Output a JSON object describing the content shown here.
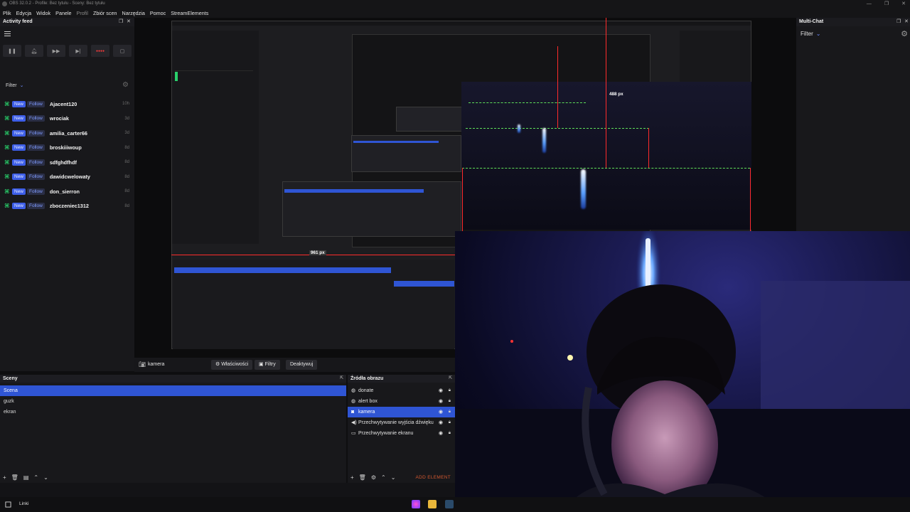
{
  "window": {
    "title": "OBS 32.0.2 - Profile: Bez tytułu - Sceny: Bez tytułu",
    "controls": [
      "—",
      "❐",
      "✕"
    ]
  },
  "menu": {
    "items": [
      "Plik",
      "Edycja",
      "Widok",
      "Panele",
      "Profil",
      "Zbiór scen",
      "Narzędzia",
      "Pomoc",
      "StreamElements"
    ]
  },
  "activity_feed": {
    "title": "Activity feed",
    "filter_label": "Filter",
    "badge_new": "New",
    "badge_follow": "Follow",
    "items": [
      {
        "name": "Ajacent120",
        "time": "10h"
      },
      {
        "name": "wrociak",
        "time": "3d"
      },
      {
        "name": "amilia_carter66",
        "time": "3d"
      },
      {
        "name": "broskiiiwoup",
        "time": "8d"
      },
      {
        "name": "sdfghdfhdf",
        "time": "8d"
      },
      {
        "name": "dawidcwelowaty",
        "time": "8d"
      },
      {
        "name": "don_sierron",
        "time": "8d"
      },
      {
        "name": "zboczeniec1312",
        "time": "8d"
      }
    ]
  },
  "preview": {
    "label_488": "488 px",
    "label_961": "961 px"
  },
  "multi_chat": {
    "title": "Multi-Chat",
    "filter_label": "Filter"
  },
  "source_toolbar": {
    "source_name": "kamera",
    "properties_button": "Właściwości",
    "filters_button": "Filtry",
    "deactivate_button": "Deaktywuj"
  },
  "scenes": {
    "title": "Sceny",
    "items": [
      "Scena",
      "guzk",
      "ekran"
    ],
    "selected": "Scena"
  },
  "sources": {
    "title": "Źródła obrazu",
    "items": [
      {
        "name": "donate",
        "icon": "globe-icon"
      },
      {
        "name": "alert box",
        "icon": "globe-icon"
      },
      {
        "name": "kamera",
        "icon": "camera-icon"
      },
      {
        "name": "Przechwytywanie wyjścia dźwięku",
        "icon": "speaker-icon"
      },
      {
        "name": "Przechwytywanie ekranu",
        "icon": "monitor-icon"
      }
    ],
    "selected": "kamera",
    "add_element": "ADD ELEMENT"
  },
  "taskbar": {
    "label": "Linki"
  },
  "colors": {
    "accent": "#2f55d4",
    "follow_green": "#29d06b",
    "record_red": "#ff3b3b",
    "guide_green": "#5fe05a",
    "guide_red": "#ff2b2b"
  }
}
